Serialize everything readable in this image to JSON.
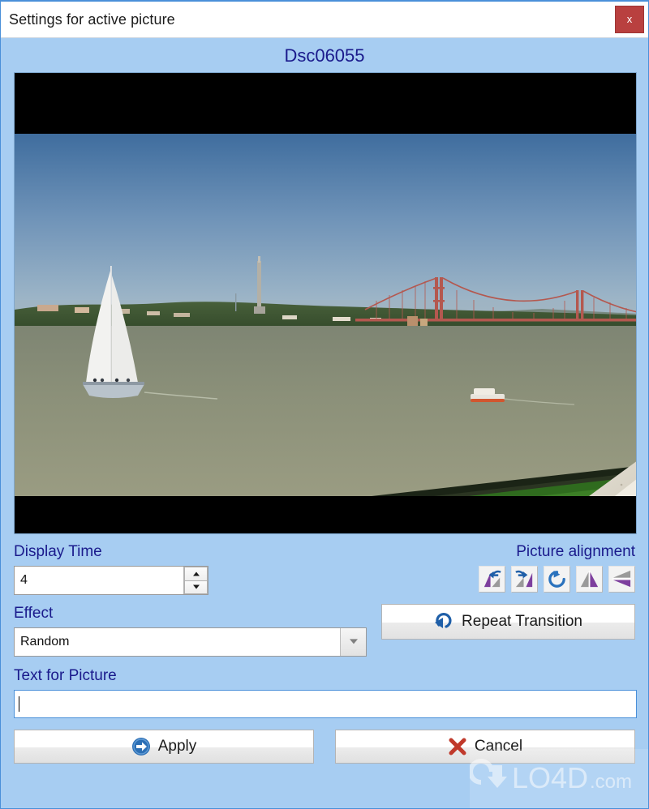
{
  "window": {
    "title": "Settings for active picture",
    "close_label": "x",
    "accent_color": "#4a90d9",
    "background_color": "#a7cdf2",
    "close_color": "#b9403f"
  },
  "picture": {
    "name": "Dsc06055",
    "title_color": "#1a1a8c",
    "scene": "Lisbon waterfront with sailboat, 25 de Abril Bridge and Cristo Rei statue, letterboxed with black bars"
  },
  "display_time": {
    "label": "Display Time",
    "value": "4",
    "spinner_up": "increment",
    "spinner_down": "decrement"
  },
  "alignment": {
    "label": "Picture alignment",
    "buttons": [
      {
        "name": "rotate-left",
        "title": "Rotate left"
      },
      {
        "name": "rotate-right",
        "title": "Rotate right"
      },
      {
        "name": "rotate-reset",
        "title": "Rotate 180"
      },
      {
        "name": "flip-horizontal",
        "title": "Flip horizontal"
      },
      {
        "name": "flip-vertical",
        "title": "Flip vertical"
      }
    ]
  },
  "effect": {
    "label": "Effect",
    "value": "Random",
    "options": [
      "Random"
    ]
  },
  "repeat": {
    "label": "Repeat Transition",
    "icon": "repeat-arrow-icon"
  },
  "text_for_picture": {
    "label": "Text for Picture",
    "value": "",
    "placeholder": ""
  },
  "actions": {
    "apply_label": "Apply",
    "apply_icon": "arrow-right-circle-icon",
    "cancel_label": "Cancel",
    "cancel_icon": "red-x-icon"
  },
  "watermark": {
    "text": "LO4D.com"
  }
}
